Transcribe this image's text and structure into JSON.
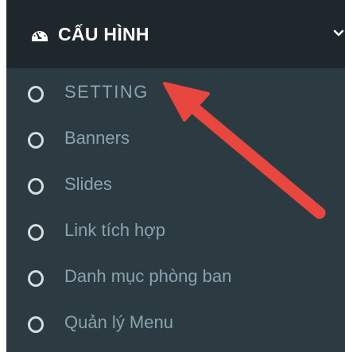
{
  "header": {
    "title": "CẤU HÌNH",
    "icon": "dashboard-icon",
    "expand_icon": "chevron-down-icon"
  },
  "menu": {
    "items": [
      {
        "label": "SETTING",
        "icon": "circle-outline-icon"
      },
      {
        "label": "Banners",
        "icon": "circle-outline-icon"
      },
      {
        "label": "Slides",
        "icon": "circle-outline-icon"
      },
      {
        "label": "Link tích hợp",
        "icon": "circle-outline-icon"
      },
      {
        "label": "Danh mục phòng ban",
        "icon": "circle-outline-icon"
      },
      {
        "label": "Quản lý Menu",
        "icon": "circle-outline-icon"
      }
    ]
  },
  "annotation": {
    "arrow_color": "#e8473f",
    "arrow_icon": "arrow-pointer-icon"
  },
  "colors": {
    "sidebar_bg": "#2c3b41",
    "header_bg": "#1e282c",
    "item_text": "#8aa4af",
    "header_text": "#ffffff"
  }
}
